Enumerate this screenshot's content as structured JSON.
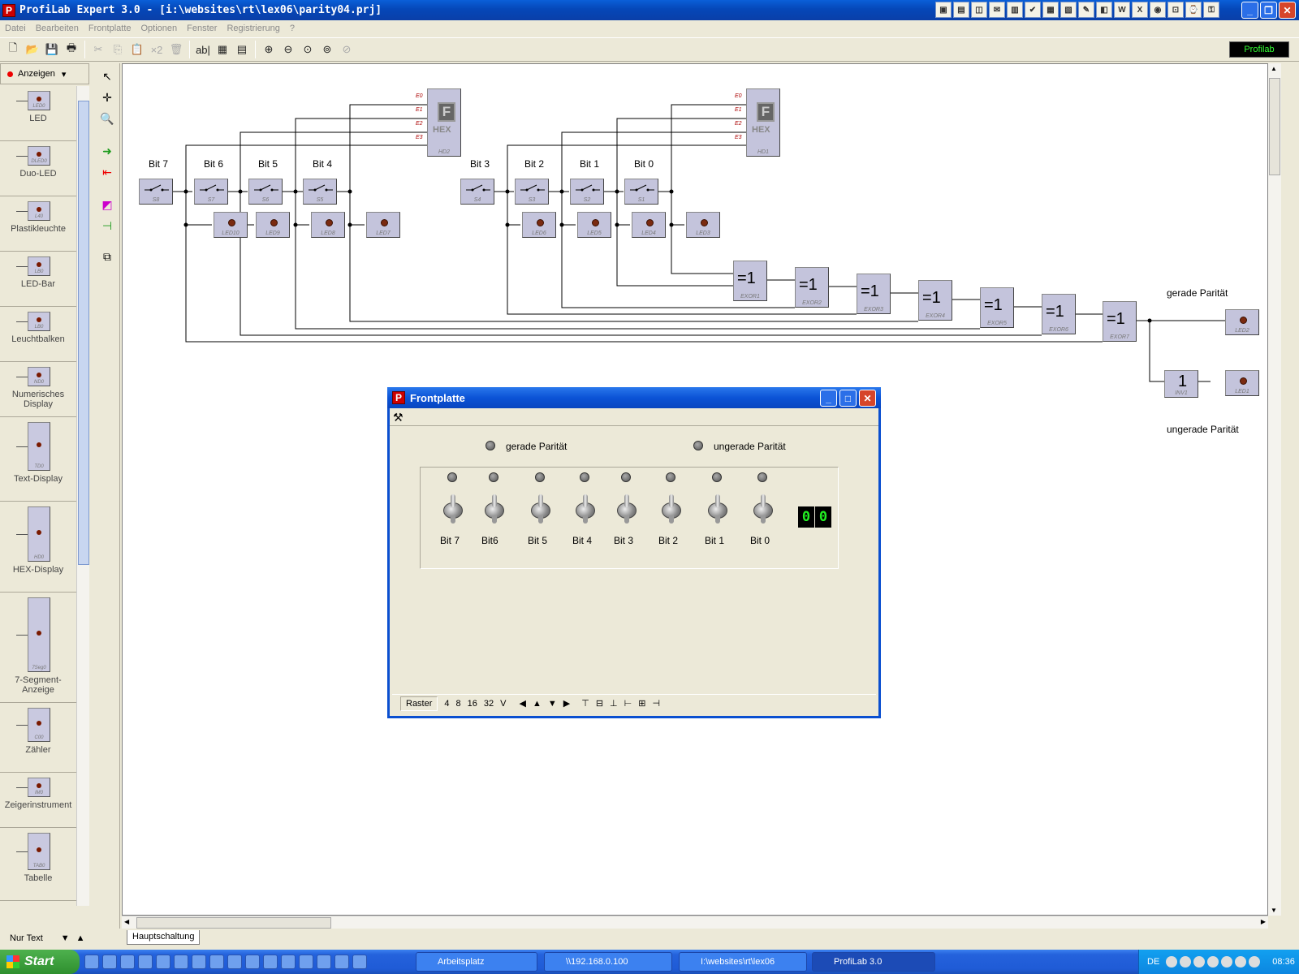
{
  "window": {
    "title": "ProfiLab Expert 3.0 - [i:\\websites\\rt\\lex06\\parity04.prj]"
  },
  "menu": [
    "Datei",
    "Bearbeiten",
    "Frontplatte",
    "Optionen",
    "Fenster",
    "Registrierung",
    "?"
  ],
  "toolbar": {
    "badge": "Profilab",
    "text_tool": "ab|",
    "zoom_buttons": [
      "zoom-in",
      "zoom-out",
      "zoom-fit",
      "zoom-window",
      "zoom-reset"
    ]
  },
  "palette": {
    "category": "Anzeigen",
    "items": [
      {
        "label": "LED",
        "tag": "LED0"
      },
      {
        "label": "Duo-LED",
        "tag": "DLED0"
      },
      {
        "label": "Plastikleuchte",
        "tag": "L40"
      },
      {
        "label": "LED-Bar",
        "tag": "LB0"
      },
      {
        "label": "Leuchtbalken",
        "tag": "LB0"
      },
      {
        "label": "Numerisches Display",
        "tag": "ND0"
      },
      {
        "label": "Text-Display",
        "tag": "TD0"
      },
      {
        "label": "HEX-Display",
        "tag": "HD0"
      },
      {
        "label": "7-Segment-Anzeige",
        "tag": "7Seg0"
      },
      {
        "label": "Zähler",
        "tag": "C00"
      },
      {
        "label": "Zeigerinstrument",
        "tag": "IM0"
      },
      {
        "label": "Tabelle",
        "tag": "TAB0"
      }
    ],
    "footer": "Nur Text"
  },
  "circuit": {
    "bit_labels": [
      "Bit 7",
      "Bit 6",
      "Bit 5",
      "Bit 4",
      "Bit 3",
      "Bit 2",
      "Bit 1",
      "Bit 0"
    ],
    "switch_tags": [
      "S8",
      "S7",
      "S6",
      "S5",
      "S4",
      "S3",
      "S2",
      "S1"
    ],
    "led_tags": [
      "LED10",
      "LED9",
      "LED8",
      "LED7",
      "LED6",
      "LED5",
      "LED4",
      "LED3"
    ],
    "hex_tags": [
      "HD2",
      "HD1"
    ],
    "hex_text": "HEX",
    "hex_digit": "F",
    "hex_pins": [
      "E0",
      "E1",
      "E2",
      "E3"
    ],
    "gate_symbol": "=1",
    "gate_tags": [
      "EXOR1",
      "EXOR2",
      "EXOR3",
      "EXOR4",
      "EXOR5",
      "EXOR6",
      "EXOR7"
    ],
    "inv_symbol": "1",
    "inv_tag": "INV1",
    "out_leds": [
      "LED2",
      "LED1"
    ],
    "label_even": "gerade Parität",
    "label_odd": "ungerade Parität"
  },
  "frontpanel": {
    "title": "Frontplatte",
    "led_even_label": "gerade Parität",
    "led_odd_label": "ungerade Parität",
    "switch_labels": [
      "Bit 7",
      "Bit6",
      "Bit 5",
      "Bit 4",
      "Bit 3",
      "Bit 2",
      "Bit 1",
      "Bit 0"
    ],
    "hex_value": [
      "0",
      "0"
    ],
    "status": {
      "raster": "Raster",
      "options": [
        "4",
        "8",
        "16",
        "32",
        "V"
      ]
    }
  },
  "scroll": {
    "tab": "Hauptschaltung"
  },
  "taskbar": {
    "start": "Start",
    "tasks": [
      "Arbeitsplatz",
      "\\\\192.168.0.100",
      "I:\\websites\\rt\\lex06",
      "ProfiLab 3.0"
    ],
    "lang": "DE",
    "clock": "08:36"
  }
}
